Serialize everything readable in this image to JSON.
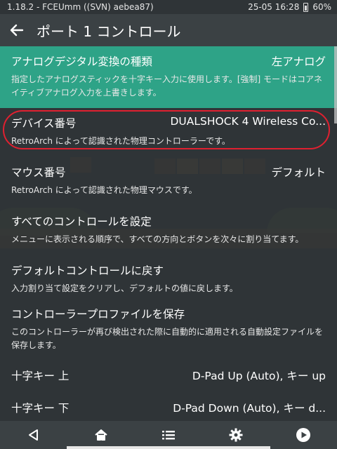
{
  "statusbar": {
    "left": "1.18.2 - FCEUmm ((SVN) aebea87)",
    "time": "25-05 16:28",
    "battery": "60%"
  },
  "header": {
    "title": "ポート 1 コントロール"
  },
  "menu": [
    {
      "label": "アナログデジタル変換の種類",
      "value": "左アナログ",
      "desc": "指定したアナログスティックを十字キー入力に使用します。[強制] モードはコアネイティブアナログ入力を上書きします。"
    },
    {
      "label": "デバイス番号",
      "value": "DUALSHOCK 4 Wireless Co...",
      "desc": "RetroArch によって認識された物理コントローラーです。"
    },
    {
      "label": "マウス番号",
      "value": "デフォルト",
      "desc": "RetroArch によって認識された物理マウスです。"
    },
    {
      "label": "すべてのコントロールを設定",
      "value": "",
      "desc": "メニューに表示される順序で、すべての方向とボタンを次々に割り当てます。"
    },
    {
      "label": "デフォルトコントロールに戻す",
      "value": "",
      "desc": "入力割り当て設定をクリアし、デフォルトの値に戻します。"
    },
    {
      "label": "コントローラープロファイルを保存",
      "value": "",
      "desc": "このコントローラーが再び検出された際に自動的に適用される自動設定ファイルを保存します。"
    },
    {
      "label": "十字キー 上",
      "value": "D-Pad Up (Auto), キー up",
      "desc": ""
    },
    {
      "label": "十字キー 下",
      "value": "D-Pad Down (Auto), キー d...",
      "desc": ""
    }
  ],
  "colors": {
    "selected": "#2ea387",
    "highlight_ring": "#e02030",
    "background": "#2f3437"
  },
  "nav": [
    "back-icon",
    "home-icon",
    "list-icon",
    "gear-icon",
    "play-icon"
  ]
}
